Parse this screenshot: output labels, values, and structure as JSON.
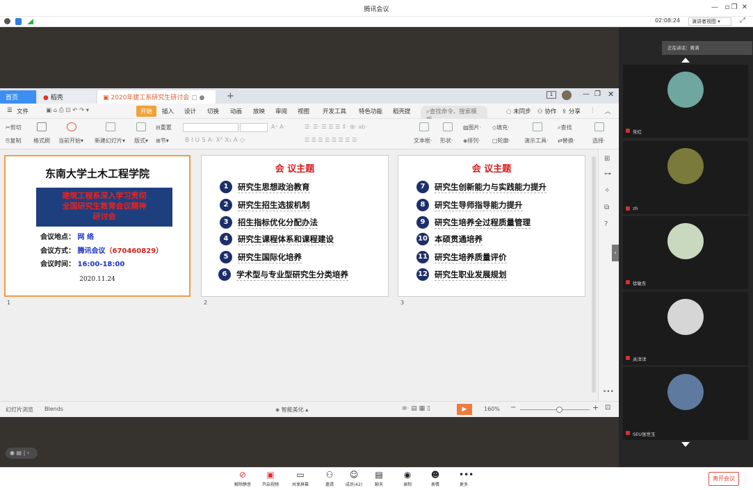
{
  "window": {
    "title": "腾讯会议",
    "timer": "02:08:24",
    "speaker_view": "演讲者视图"
  },
  "wps": {
    "tabs": {
      "home": "首页",
      "daoke": "稻壳",
      "doc": "2020年建工系研究生研讨会"
    },
    "menu": [
      "文件",
      "开始",
      "插入",
      "设计",
      "切换",
      "动画",
      "放映",
      "审阅",
      "视图",
      "开发工具",
      "特色功能",
      "稻壳提"
    ],
    "search_placeholder": "查找命令、搜索模板",
    "menu_right": {
      "sync": "未同步",
      "collab": "协作",
      "share": "分享"
    },
    "ribbon": {
      "cut": "剪切",
      "copy": "复制",
      "format_painter": "格式刷",
      "from_start": "当前开始",
      "new_slide": "新建幻灯片",
      "layout": "版式",
      "section": "节",
      "reset": "重置",
      "textbox": "文本框",
      "shape": "形状",
      "picture": "图片",
      "arrange": "排列",
      "fill": "填充",
      "outline": "轮廓",
      "presenter": "演示工具",
      "find": "查找",
      "replace": "替换",
      "select": "选择"
    },
    "slides": [
      {
        "num": "1",
        "title": "东南大学土木工程学院",
        "banner": [
          "建筑工程系深入学习贯彻",
          "全国研究生教育会议精神",
          "研讨会"
        ],
        "place_label": "会议地点：",
        "place": "网 络",
        "method_label": "会议方式：",
        "method": "腾讯会议",
        "method_code": "（670460829）",
        "time_label": "会议时间：",
        "time": "16:00-18:00",
        "date": "2020.11.24"
      },
      {
        "num": "2",
        "heading": "会 议主题",
        "items": [
          {
            "n": "1",
            "t": "研究生思想政治教育"
          },
          {
            "n": "2",
            "t": "研究生招生选拔机制"
          },
          {
            "n": "3",
            "t": "招生指标优化分配办法"
          },
          {
            "n": "4",
            "t": "研究生课程体系和课程建设"
          },
          {
            "n": "5",
            "t": "研究生国际化培养"
          },
          {
            "n": "6",
            "t": "学术型与专业型研究生分类培养"
          }
        ]
      },
      {
        "num": "3",
        "heading": "会 议主题",
        "items": [
          {
            "n": "7",
            "t": "研究生创新能力与实践能力提升"
          },
          {
            "n": "8",
            "t": "研究生导师指导能力提升"
          },
          {
            "n": "9",
            "t": "研究生培养全过程质量管理"
          },
          {
            "n": "10",
            "t": "本硕贯通培养"
          },
          {
            "n": "11",
            "t": "研究生培养质量评价"
          },
          {
            "n": "12",
            "t": "研究生职业发展规划"
          }
        ]
      }
    ],
    "status": {
      "view": "幻灯片浏览",
      "theme": "Blends",
      "beautify": "智能美化",
      "zoom": "160%"
    }
  },
  "participants": {
    "speaking": "正在讲话：黄满",
    "tiles": [
      {
        "name": "朱红",
        "color": "#6fa6a0"
      },
      {
        "name": "zh",
        "color": "#7a7a3a"
      },
      {
        "name": "徐敏东",
        "color": "#c9d9c0"
      },
      {
        "name": "关洋洋",
        "color": "#d6d6d6"
      },
      {
        "name": "SEU张世玉",
        "color": "#5e7a9e"
      }
    ]
  },
  "bottom": {
    "mute": "解除静音",
    "video": "开启视频",
    "share": "共享屏幕",
    "invite": "邀请",
    "members": "成员(42)",
    "chat": "聊天",
    "record": "录制",
    "reaction": "表情",
    "more": "更多",
    "leave": "离开会议"
  }
}
